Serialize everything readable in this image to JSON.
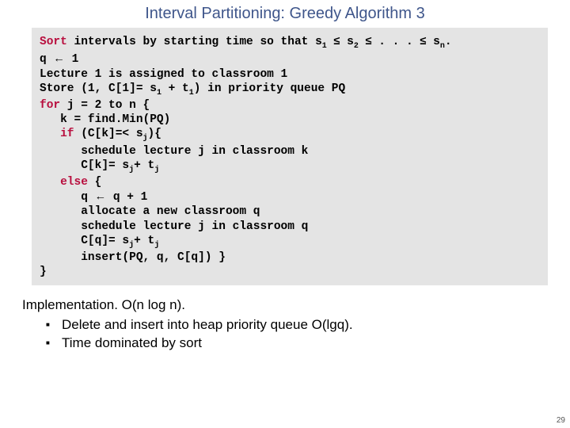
{
  "title": "Interval Partitioning:  Greedy Algorithm 3",
  "code": {
    "l1a": "Sort",
    "l1b": " intervals by starting time so that s",
    "l1s1": "1",
    "l1c": " ",
    "l1le1": "≤",
    "l1d": " s",
    "l1s2": "2",
    "l1e": " ",
    "l1le2": "≤",
    "l1f": " . . . ",
    "l1le3": "≤",
    "l1g": " s",
    "l1sn": "n",
    "l1h": ".",
    "l2a": "q ",
    "l2arrow": "←",
    "l2b": " 1",
    "l3": "Lecture 1 is assigned to classroom 1",
    "l4a": "Store (1, C[1]= s",
    "l4s1": "1",
    "l4b": " + t",
    "l4s2": "1",
    "l4c": ") in priority queue PQ",
    "l5a": "for",
    "l5b": " j = 2 to n {",
    "l6": "   k = find.Min(PQ)",
    "l7a": "   ",
    "l7if": "if",
    "l7b": " (C[k]=< s",
    "l7s": "j",
    "l7c": "){",
    "l8": "      schedule lecture j in classroom k",
    "l9a": "      C[k]= s",
    "l9s1": "j",
    "l9b": "+ t",
    "l9s2": "j",
    "l10a": "   ",
    "l10else": "else",
    "l10b": " {",
    "l11a": "      q ",
    "l11arrow": "←",
    "l11b": " q + 1",
    "l12": "      allocate a new classroom q",
    "l13": "      schedule lecture j in classroom q",
    "l14a": "      C[q]= s",
    "l14s1": "j",
    "l14b": "+ t",
    "l14s2": "j",
    "l15": "      insert(PQ, q, C[q]) }",
    "l16": "}"
  },
  "impl": {
    "header": "Implementation.  O(n log n).",
    "b1": "Delete and insert into heap priority queue O(lgq).",
    "b2": "Time dominated by sort"
  },
  "pagenum": "29"
}
